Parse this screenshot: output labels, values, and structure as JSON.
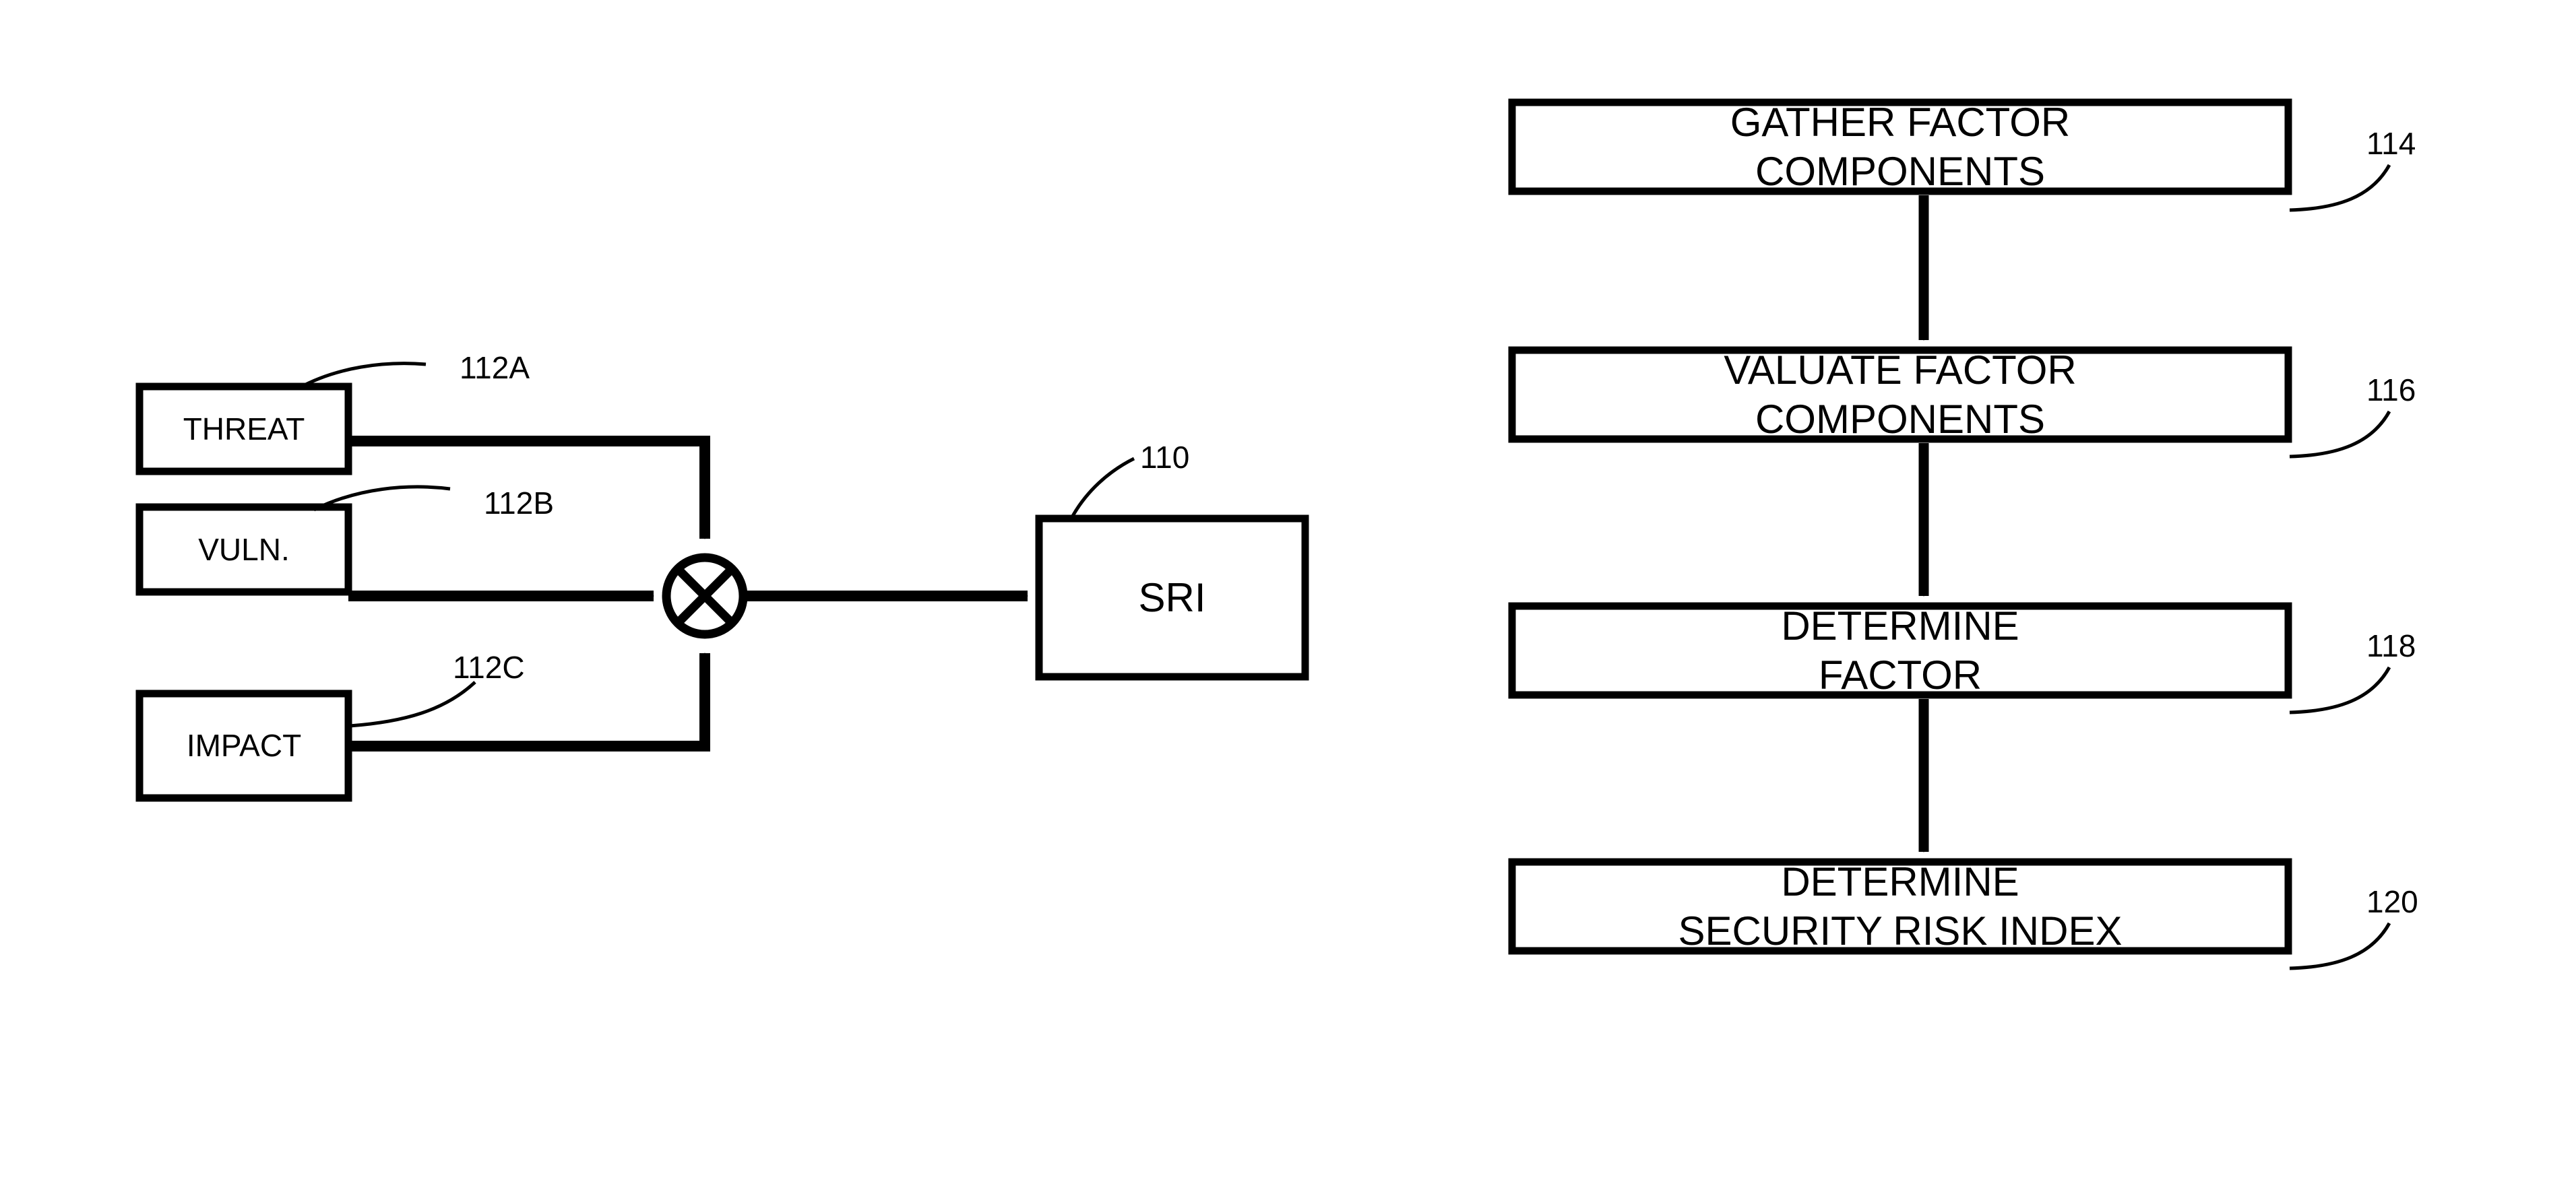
{
  "figure": {
    "type": "patent-diagram",
    "background_color": "#ffffff",
    "line_color": "#000000"
  },
  "left_diagram": {
    "name": "security-risk-index-computation",
    "input_blocks": [
      {
        "label": "THREAT",
        "ref": "112A"
      },
      {
        "label": "VULN.",
        "ref": "112B"
      },
      {
        "label": "IMPACT",
        "ref": "112C"
      }
    ],
    "operator": {
      "symbol": "multiply",
      "glyph": "X-in-circle",
      "name": "multiplier-node"
    },
    "output_block": {
      "label": "SRI",
      "ref": "110"
    }
  },
  "right_flowchart": {
    "name": "security-risk-index-method",
    "steps": [
      {
        "label": "GATHER FACTOR\nCOMPONENTS",
        "ref": "114"
      },
      {
        "label": "VALUATE FACTOR\nCOMPONENTS",
        "ref": "116"
      },
      {
        "label": "DETERMINE\nFACTOR",
        "ref": "118"
      },
      {
        "label": "DETERMINE\nSECURITY RISK INDEX",
        "ref": "120"
      }
    ]
  }
}
